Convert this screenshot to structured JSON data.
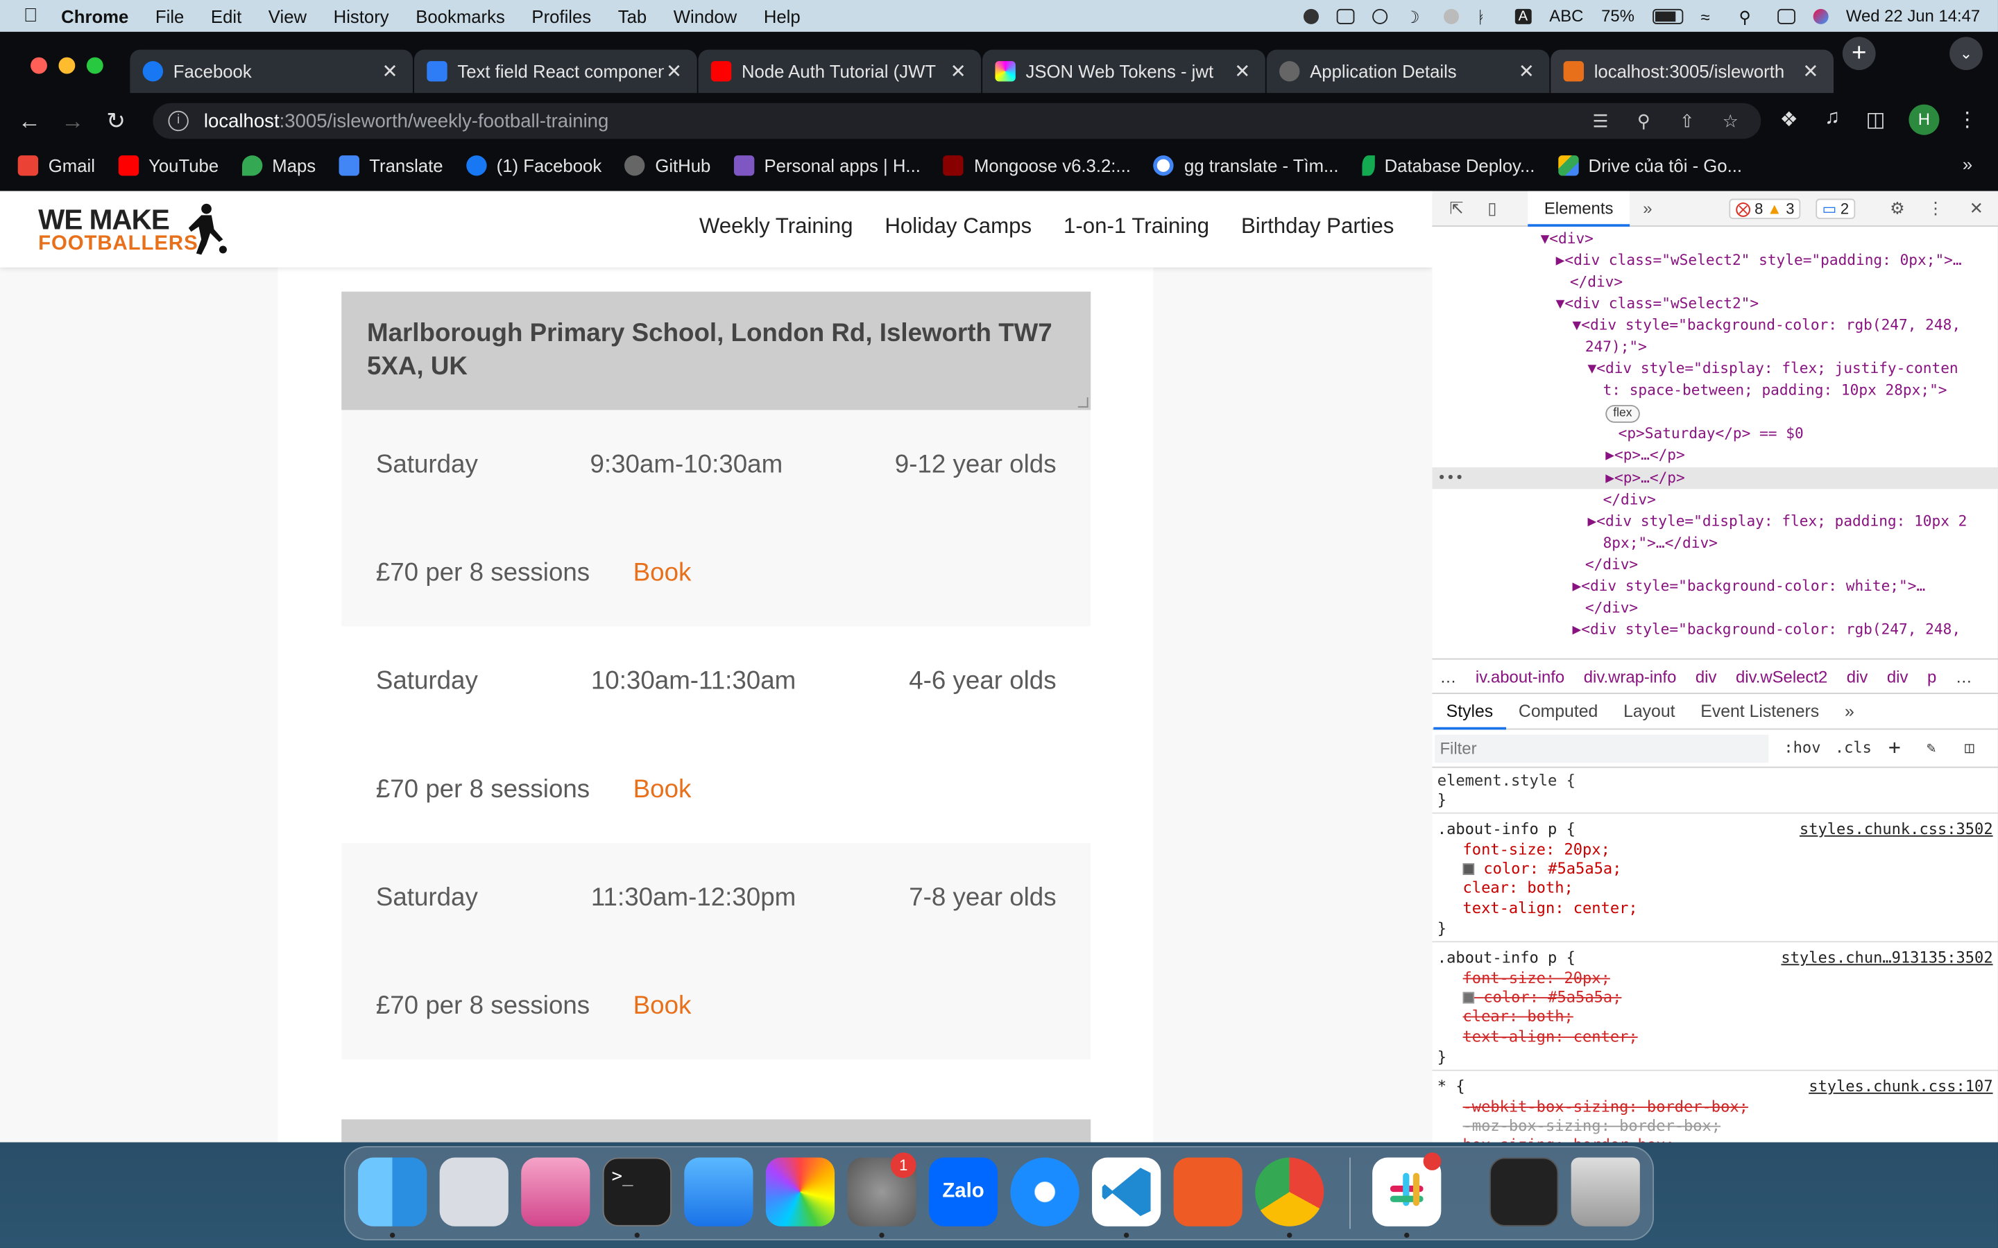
{
  "menubar": {
    "app": "Chrome",
    "items": [
      "File",
      "Edit",
      "View",
      "History",
      "Bookmarks",
      "Profiles",
      "Tab",
      "Window",
      "Help"
    ],
    "input_method": "ABC",
    "battery": "75%",
    "datetime": "Wed 22 Jun  14:47"
  },
  "tabs": [
    {
      "title": "Facebook",
      "color": "#1877f2"
    },
    {
      "title": "Text field React component",
      "color": "#2e7df6"
    },
    {
      "title": "Node Auth Tutorial (JWT",
      "color": "#ff0000"
    },
    {
      "title": "JSON Web Tokens - jwt",
      "color": "#111111"
    },
    {
      "title": "Application Details",
      "color": "#555555"
    },
    {
      "title": "localhost:3005/isleworth",
      "color": "#e8701b"
    }
  ],
  "omnibox": {
    "host": "localhost",
    "path": ":3005/isleworth/weekly-football-training"
  },
  "profile_initial": "H",
  "bookmarks": [
    {
      "label": "Gmail",
      "color": "#ea4335"
    },
    {
      "label": "YouTube",
      "color": "#ff0000"
    },
    {
      "label": "Maps",
      "color": "#34a853"
    },
    {
      "label": "Translate",
      "color": "#4285f4"
    },
    {
      "label": "(1) Facebook",
      "color": "#1877f2"
    },
    {
      "label": "GitHub",
      "color": "#666666"
    },
    {
      "label": "Personal apps | H...",
      "color": "#7e57c2"
    },
    {
      "label": "Mongoose v6.3.2:...",
      "color": "#880000"
    },
    {
      "label": "gg translate - Tìm...",
      "color": "#4285f4"
    },
    {
      "label": "Database Deploy...",
      "color": "#13aa52"
    },
    {
      "label": "Drive của tôi - Go...",
      "color": "#fbbc04"
    }
  ],
  "bookmarks_more": "»",
  "site": {
    "logo_line1": "WE MAKE",
    "logo_line2": "FOOTBALLERS",
    "nav": [
      "Weekly Training",
      "Holiday Camps",
      "1-on-1 Training",
      "Birthday Parties"
    ],
    "location": "Marlborough Primary School, London Rd, Isleworth TW7 5XA, UK",
    "slots": [
      {
        "day": "Saturday",
        "time": "9:30am-10:30am",
        "age": "9-12 year olds",
        "price": "£70 per 8 sessions",
        "book": "Book",
        "bg": "#f7f7f7"
      },
      {
        "day": "Saturday",
        "time": "10:30am-11:30am",
        "age": "4-6 year olds",
        "price": "£70 per 8 sessions",
        "book": "Book",
        "bg": "#ffffff"
      },
      {
        "day": "Saturday",
        "time": "11:30am-12:30pm",
        "age": "7-8 year olds",
        "price": "£70 per 8 sessions",
        "book": "Book",
        "bg": "#f7f7f7"
      }
    ]
  },
  "devtools": {
    "panel": "Elements",
    "errors": "8",
    "warnings": "3",
    "messages": "2",
    "code_lines": [
      "<div>",
      "<div class=\"wSelect2\" style=\"padding: 0px;\">…",
      "</div>",
      "<div class=\"wSelect2\">",
      "<div style=\"background-color: rgb(247, 248,",
      "247);\">",
      "<div style=\"display: flex; justify-conten",
      "t: space-between; padding: 10px 28px;\">",
      "flex",
      "<p>Saturday</p> == $0",
      "<p>…</p>",
      "<p>…</p>",
      "</div>",
      "<div style=\"display: flex; padding: 10px 2",
      "8px;\">…</div>",
      "</div>",
      "<div style=\"background-color: white;\">…",
      "</div>",
      "<div style=\"background-color: rgb(247, 248,"
    ],
    "breadcrumbs": [
      "…",
      "iv.about-info",
      "div.wrap-info",
      "div",
      "div.wSelect2",
      "div",
      "div",
      "p",
      "…"
    ],
    "subtabs": [
      "Styles",
      "Computed",
      "Layout",
      "Event Listeners",
      "»"
    ],
    "filter_placeholder": "Filter",
    "hov": ":hov",
    "cls": ".cls",
    "rules": {
      "element_style": "element.style {",
      "close": "}",
      "r1_selector": ".about-info p {",
      "r1_source": "styles.chunk.css:3502",
      "r1_props": [
        "font-size: 20px;",
        "color: #5a5a5a;",
        "clear: both;",
        "text-align: center;"
      ],
      "r2_selector": ".about-info p {",
      "r2_source": "styles.chun…913135:3502",
      "r2_props": [
        "font-size: 20px;",
        "color: #5a5a5a;",
        "clear: both;",
        "text-align: center;"
      ],
      "r3_selector": "* {",
      "r3_source": "styles.chunk.css:107",
      "r3_props": [
        "-webkit-box-sizing: border-box;",
        "-moz-box-sizing: border-box;",
        "box-sizing: border-box;"
      ]
    }
  },
  "dock": {
    "badge_settings": "1"
  }
}
